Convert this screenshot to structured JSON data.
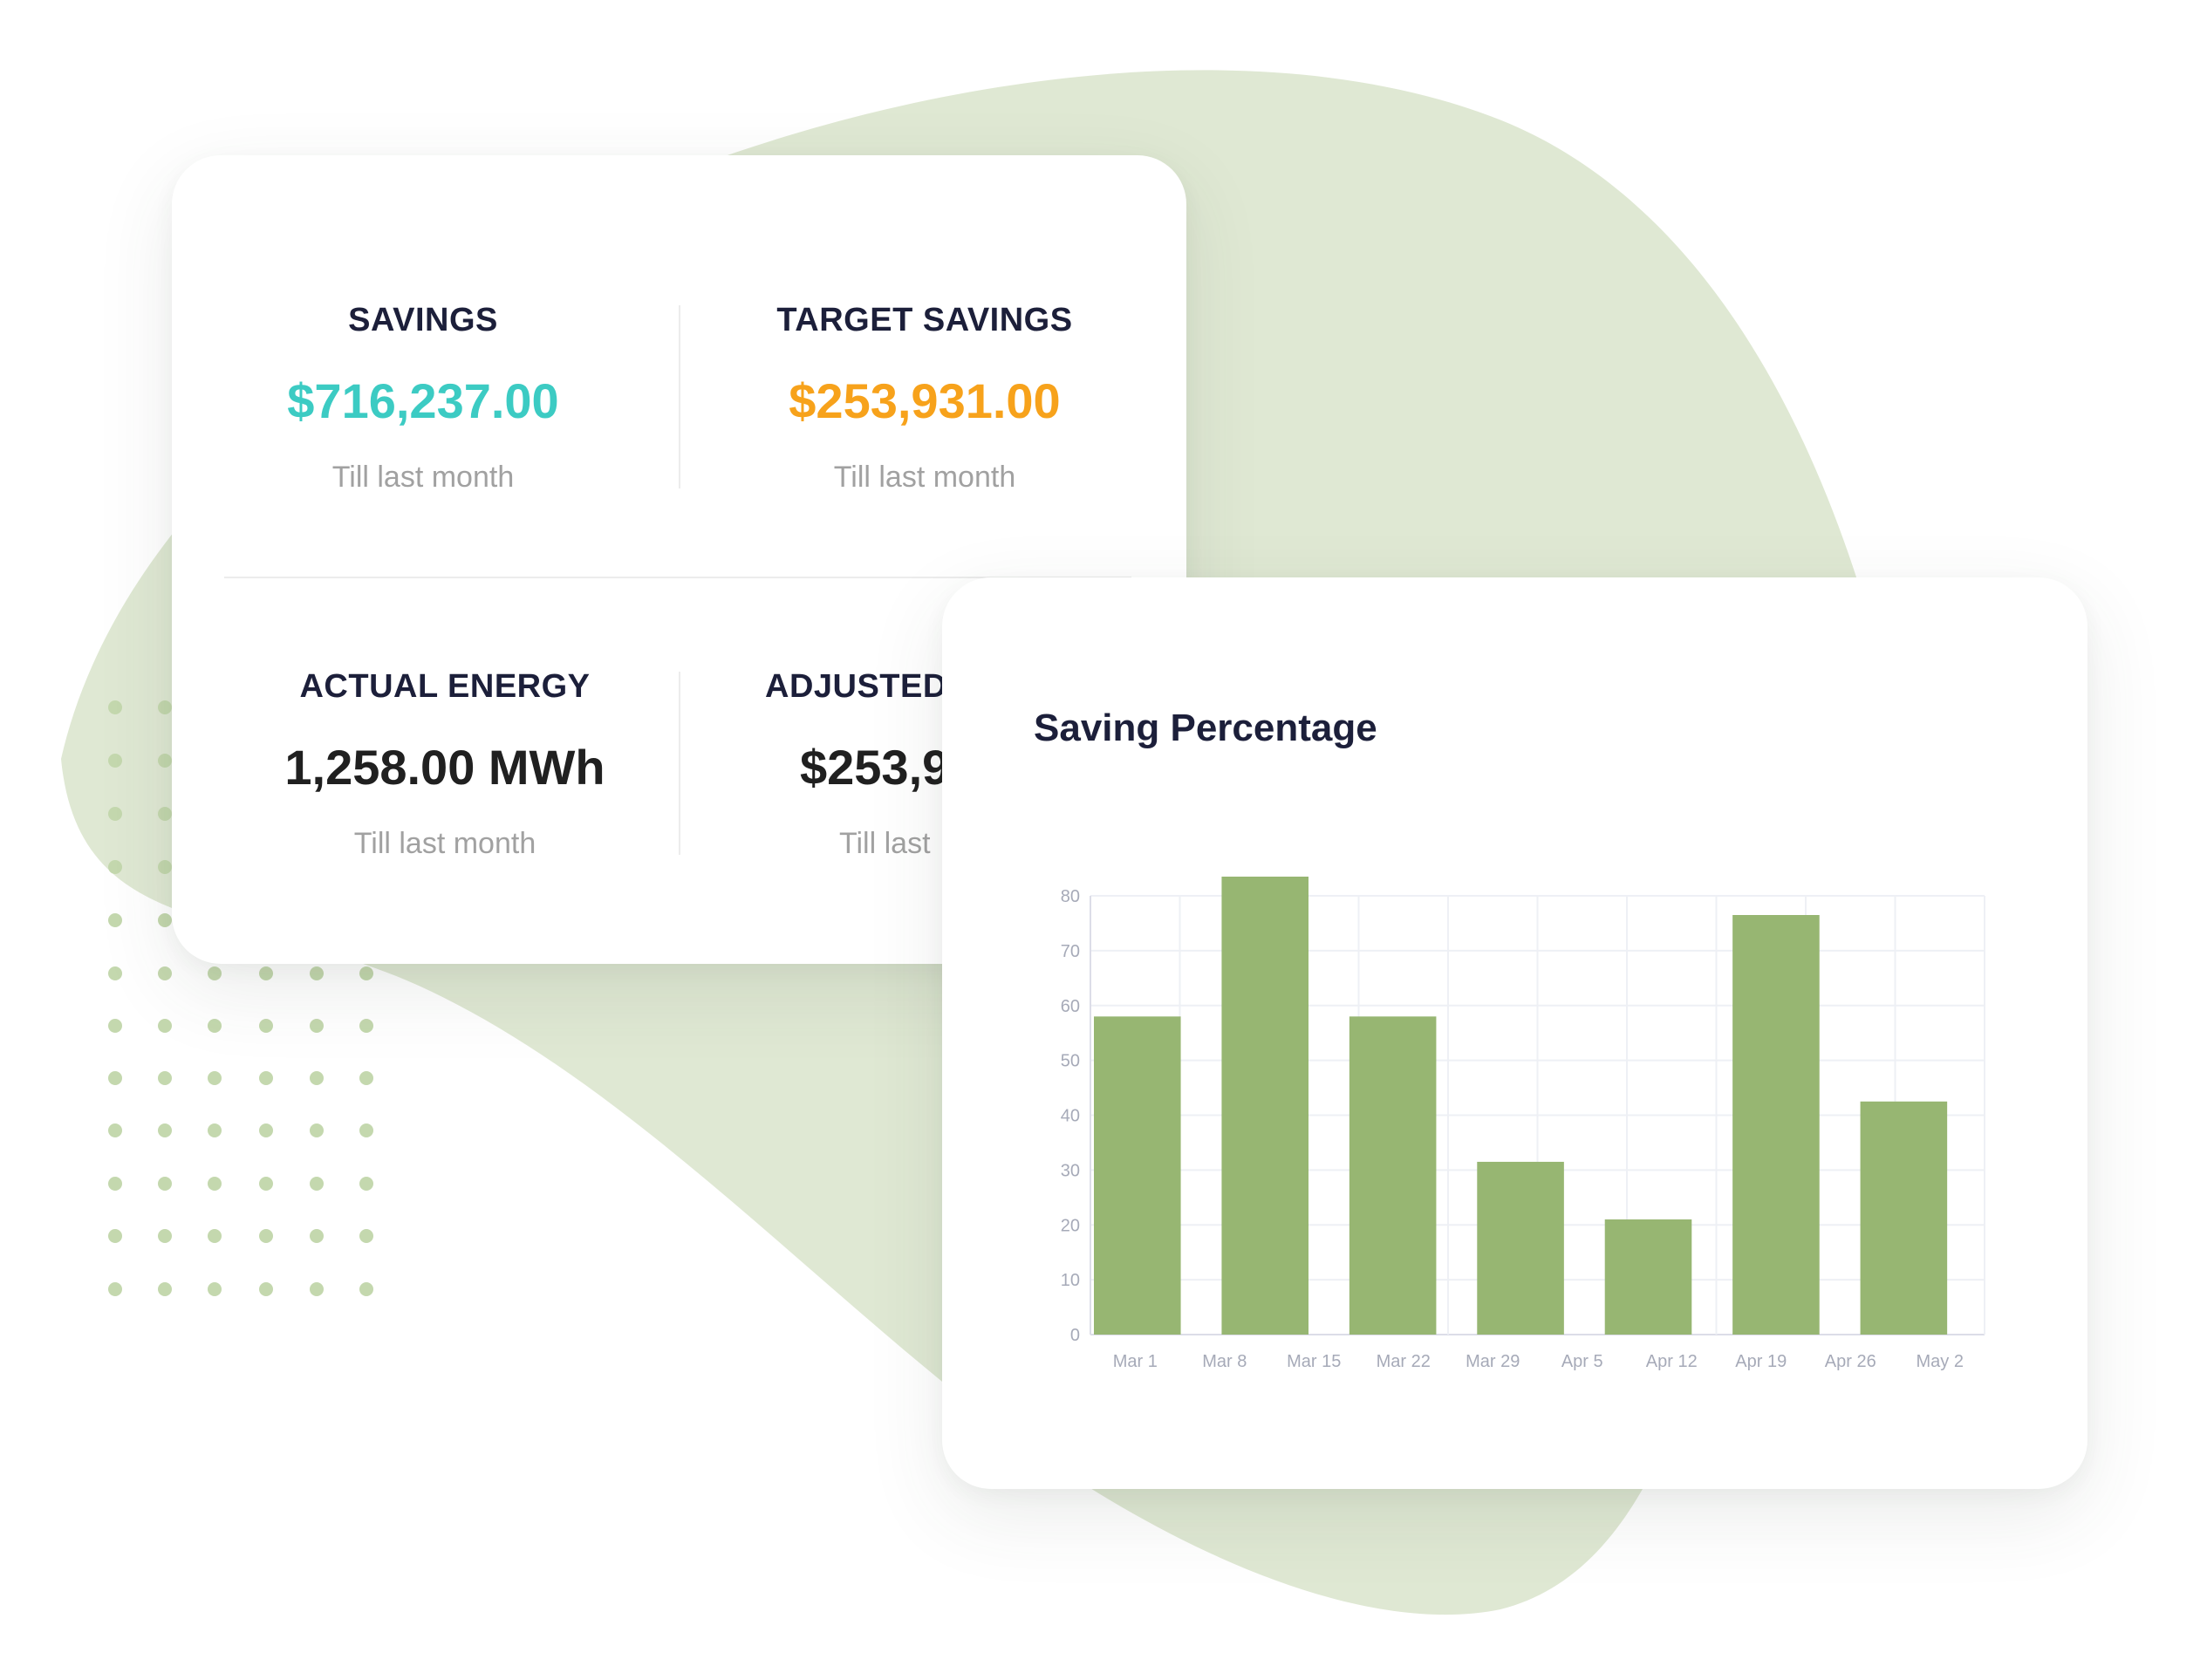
{
  "colors": {
    "blob": "#dfe8d3",
    "dots": "#c4d8ae",
    "bar": "#97b672",
    "title": "#1c1f3a",
    "savings_value": "#3ccbc3",
    "target_value": "#f7a21b",
    "dark_value": "#202020",
    "subtext": "#a1a1a1"
  },
  "stats": {
    "savings": {
      "title": "SAVINGS",
      "value": "$716,237.00",
      "sub": "Till last month"
    },
    "target_savings": {
      "title": "TARGET SAVINGS",
      "value": "$253,931.00",
      "sub": "Till last month"
    },
    "actual_energy": {
      "title": "ACTUAL ENERGY",
      "value": "1,258.00 MWh",
      "sub": "Till last month"
    },
    "adjusted": {
      "title": "ADJUSTED",
      "value": "$253,9",
      "sub": "Till last"
    }
  },
  "chart": {
    "title": "Saving Percentage"
  },
  "chart_data": {
    "type": "bar",
    "title": "Saving Percentage",
    "xlabel": "",
    "ylabel": "",
    "x_ticks": [
      "Mar 1",
      "Mar 8",
      "Mar 15",
      "Mar 22",
      "Mar 29",
      "Apr 5",
      "Apr 12",
      "Apr 19",
      "Apr 26",
      "May 2"
    ],
    "y_ticks": [
      0,
      10,
      20,
      30,
      40,
      50,
      60,
      70,
      80
    ],
    "ylim": [
      0,
      80
    ],
    "bars": [
      58,
      83.5,
      58,
      31.5,
      21,
      76.5,
      42.5
    ],
    "grid": true,
    "legend": "none"
  }
}
